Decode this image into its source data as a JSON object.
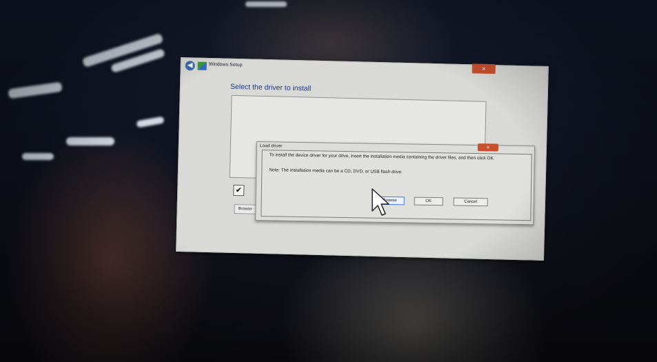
{
  "setup_window": {
    "title": "Windows Setup",
    "heading": "Select the driver to install",
    "close_label": "×",
    "back_label": "◀",
    "checkbox_mark": "✔",
    "side_button_label": "Browse"
  },
  "load_driver_dialog": {
    "title": "Load driver",
    "close_label": "×",
    "message": "To install the device driver for your drive, insert the installation media containing the driver files, and then click OK.",
    "note": "Note: The installation media can be a CD, DVD, or USB flash drive.",
    "buttons": {
      "browse": "Browse",
      "ok": "OK",
      "cancel": "Cancel"
    }
  }
}
